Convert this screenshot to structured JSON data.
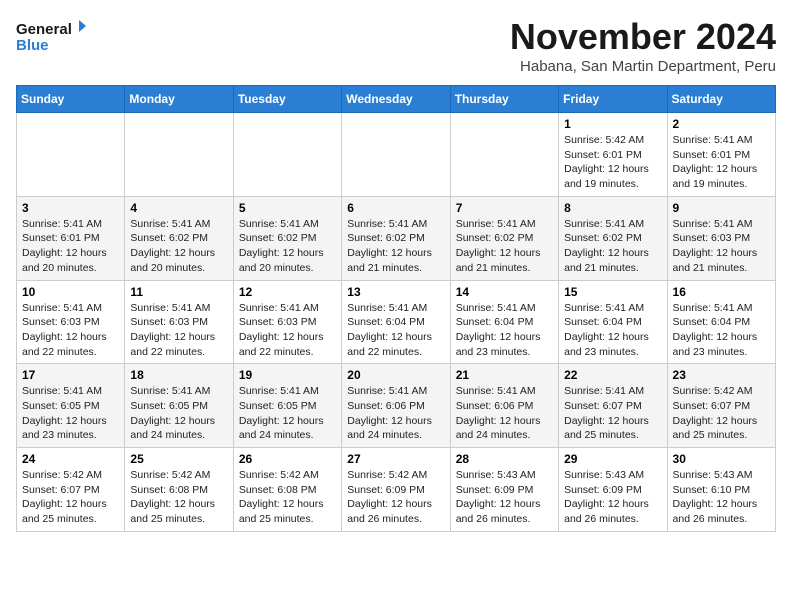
{
  "header": {
    "logo_line1": "General",
    "logo_line2": "Blue",
    "month": "November 2024",
    "location": "Habana, San Martin Department, Peru"
  },
  "weekdays": [
    "Sunday",
    "Monday",
    "Tuesday",
    "Wednesday",
    "Thursday",
    "Friday",
    "Saturday"
  ],
  "weeks": [
    [
      {
        "day": "",
        "info": ""
      },
      {
        "day": "",
        "info": ""
      },
      {
        "day": "",
        "info": ""
      },
      {
        "day": "",
        "info": ""
      },
      {
        "day": "",
        "info": ""
      },
      {
        "day": "1",
        "info": "Sunrise: 5:42 AM\nSunset: 6:01 PM\nDaylight: 12 hours and 19 minutes."
      },
      {
        "day": "2",
        "info": "Sunrise: 5:41 AM\nSunset: 6:01 PM\nDaylight: 12 hours and 19 minutes."
      }
    ],
    [
      {
        "day": "3",
        "info": "Sunrise: 5:41 AM\nSunset: 6:01 PM\nDaylight: 12 hours and 20 minutes."
      },
      {
        "day": "4",
        "info": "Sunrise: 5:41 AM\nSunset: 6:02 PM\nDaylight: 12 hours and 20 minutes."
      },
      {
        "day": "5",
        "info": "Sunrise: 5:41 AM\nSunset: 6:02 PM\nDaylight: 12 hours and 20 minutes."
      },
      {
        "day": "6",
        "info": "Sunrise: 5:41 AM\nSunset: 6:02 PM\nDaylight: 12 hours and 21 minutes."
      },
      {
        "day": "7",
        "info": "Sunrise: 5:41 AM\nSunset: 6:02 PM\nDaylight: 12 hours and 21 minutes."
      },
      {
        "day": "8",
        "info": "Sunrise: 5:41 AM\nSunset: 6:02 PM\nDaylight: 12 hours and 21 minutes."
      },
      {
        "day": "9",
        "info": "Sunrise: 5:41 AM\nSunset: 6:03 PM\nDaylight: 12 hours and 21 minutes."
      }
    ],
    [
      {
        "day": "10",
        "info": "Sunrise: 5:41 AM\nSunset: 6:03 PM\nDaylight: 12 hours and 22 minutes."
      },
      {
        "day": "11",
        "info": "Sunrise: 5:41 AM\nSunset: 6:03 PM\nDaylight: 12 hours and 22 minutes."
      },
      {
        "day": "12",
        "info": "Sunrise: 5:41 AM\nSunset: 6:03 PM\nDaylight: 12 hours and 22 minutes."
      },
      {
        "day": "13",
        "info": "Sunrise: 5:41 AM\nSunset: 6:04 PM\nDaylight: 12 hours and 22 minutes."
      },
      {
        "day": "14",
        "info": "Sunrise: 5:41 AM\nSunset: 6:04 PM\nDaylight: 12 hours and 23 minutes."
      },
      {
        "day": "15",
        "info": "Sunrise: 5:41 AM\nSunset: 6:04 PM\nDaylight: 12 hours and 23 minutes."
      },
      {
        "day": "16",
        "info": "Sunrise: 5:41 AM\nSunset: 6:04 PM\nDaylight: 12 hours and 23 minutes."
      }
    ],
    [
      {
        "day": "17",
        "info": "Sunrise: 5:41 AM\nSunset: 6:05 PM\nDaylight: 12 hours and 23 minutes."
      },
      {
        "day": "18",
        "info": "Sunrise: 5:41 AM\nSunset: 6:05 PM\nDaylight: 12 hours and 24 minutes."
      },
      {
        "day": "19",
        "info": "Sunrise: 5:41 AM\nSunset: 6:05 PM\nDaylight: 12 hours and 24 minutes."
      },
      {
        "day": "20",
        "info": "Sunrise: 5:41 AM\nSunset: 6:06 PM\nDaylight: 12 hours and 24 minutes."
      },
      {
        "day": "21",
        "info": "Sunrise: 5:41 AM\nSunset: 6:06 PM\nDaylight: 12 hours and 24 minutes."
      },
      {
        "day": "22",
        "info": "Sunrise: 5:41 AM\nSunset: 6:07 PM\nDaylight: 12 hours and 25 minutes."
      },
      {
        "day": "23",
        "info": "Sunrise: 5:42 AM\nSunset: 6:07 PM\nDaylight: 12 hours and 25 minutes."
      }
    ],
    [
      {
        "day": "24",
        "info": "Sunrise: 5:42 AM\nSunset: 6:07 PM\nDaylight: 12 hours and 25 minutes."
      },
      {
        "day": "25",
        "info": "Sunrise: 5:42 AM\nSunset: 6:08 PM\nDaylight: 12 hours and 25 minutes."
      },
      {
        "day": "26",
        "info": "Sunrise: 5:42 AM\nSunset: 6:08 PM\nDaylight: 12 hours and 25 minutes."
      },
      {
        "day": "27",
        "info": "Sunrise: 5:42 AM\nSunset: 6:09 PM\nDaylight: 12 hours and 26 minutes."
      },
      {
        "day": "28",
        "info": "Sunrise: 5:43 AM\nSunset: 6:09 PM\nDaylight: 12 hours and 26 minutes."
      },
      {
        "day": "29",
        "info": "Sunrise: 5:43 AM\nSunset: 6:09 PM\nDaylight: 12 hours and 26 minutes."
      },
      {
        "day": "30",
        "info": "Sunrise: 5:43 AM\nSunset: 6:10 PM\nDaylight: 12 hours and 26 minutes."
      }
    ]
  ]
}
